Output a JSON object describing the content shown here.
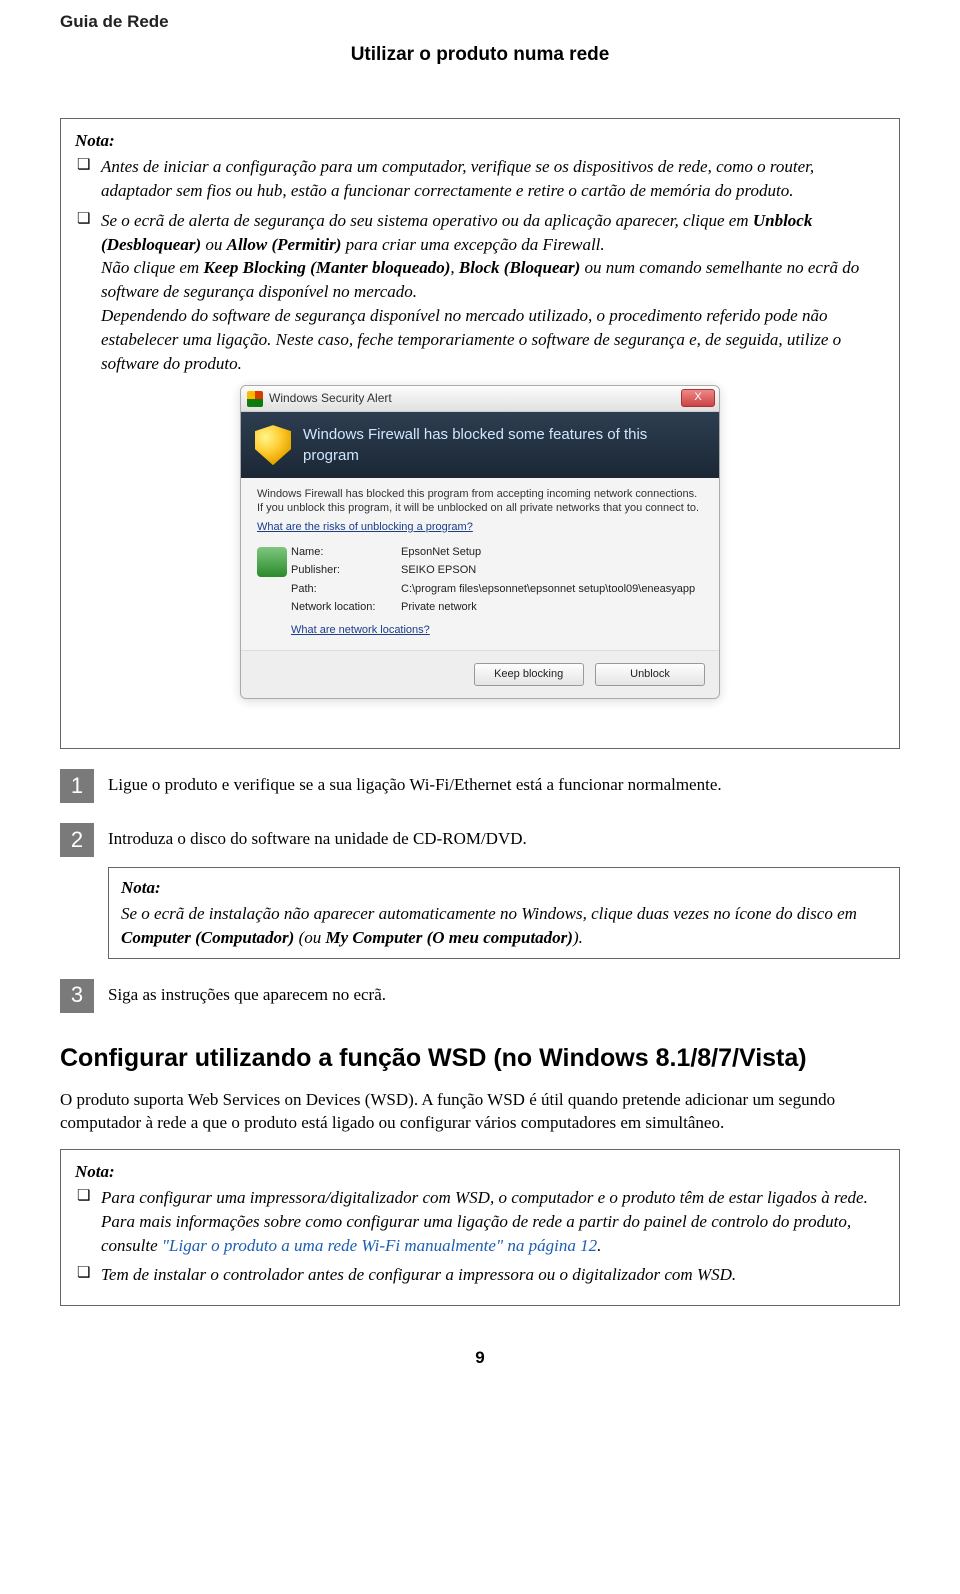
{
  "meta": {
    "running_head": "Guia de Rede",
    "chapter_title": "Utilizar o produto numa rede",
    "page_number": "9"
  },
  "note1": {
    "title": "Nota:",
    "items": [
      {
        "text": "Antes de iniciar a configuração para um computador, verifique se os dispositivos de rede, como o router, adaptador sem fios ou hub, estão a funcionar correctamente e retire o cartão de memória do produto."
      },
      {
        "html": "Se o ecrã de alerta de segurança do seu sistema operativo ou da aplicação aparecer, clique em <span class=\"bold-run\">Unblock (Desbloquear)</span> ou <span class=\"bold-run\">Allow (Permitir)</span> para criar uma excepção da Firewall.<br>Não clique em <span class=\"bold-run\">Keep Blocking (Manter bloqueado)</span>, <span class=\"bold-run\">Block (Bloquear)</span> ou num comando semelhante no ecrã do software de segurança disponível no mercado.<br>Dependendo do software de segurança disponível no mercado utilizado, o procedimento referido pode não estabelecer uma ligação. Neste caso, feche temporariamente o software de segurança e, de seguida, utilize o software do produto."
      }
    ]
  },
  "dialog": {
    "title": "Windows Security Alert",
    "banner": "Windows Firewall has blocked some features of this program",
    "intro": "Windows Firewall has blocked this program from accepting incoming network connections. If you unblock this program, it will be unblocked on all private networks that you connect to.",
    "risk_link": "What are the risks of unblocking a program?",
    "fields": {
      "name_label": "Name:",
      "name_value": "EpsonNet Setup",
      "publisher_label": "Publisher:",
      "publisher_value": "SEIKO EPSON",
      "path_label": "Path:",
      "path_value": "C:\\program files\\epsonnet\\epsonnet setup\\tool09\\eneasyapp",
      "netloc_label": "Network location:",
      "netloc_value": "Private network",
      "netloc_link": "What are network locations?"
    },
    "buttons": {
      "keep": "Keep blocking",
      "unblock": "Unblock"
    },
    "close_label": "X"
  },
  "steps": {
    "s1": {
      "num": "1",
      "text": "Ligue o produto e verifique se a sua ligação Wi-Fi/Ethernet está a funcionar normalmente."
    },
    "s2": {
      "num": "2",
      "text": "Introduza o disco do software na unidade de CD-ROM/DVD."
    },
    "s2_note": {
      "title": "Nota:",
      "html": "Se o ecrã de instalação não aparecer automaticamente no Windows, clique duas vezes no ícone do disco em <span class=\"bold-run\">Computer (Computador)</span> (ou <span class=\"bold-run\">My Computer (O meu computador)</span>)."
    },
    "s3": {
      "num": "3",
      "text": "Siga as instruções que aparecem no ecrã."
    }
  },
  "section": {
    "heading": "Configurar utilizando a função WSD (no Windows 8.1/8/7/Vista)",
    "para": "O produto suporta Web Services on Devices (WSD). A função WSD é útil quando pretende adicionar um segundo computador à rede a que o produto está ligado ou configurar vários computadores em simultâneo."
  },
  "note2": {
    "title": "Nota:",
    "items": [
      {
        "html": "Para configurar uma impressora/digitalizador com WSD, o computador e o produto têm de estar ligados à rede. Para mais informações sobre como configurar uma ligação de rede a partir do painel de controlo do produto, consulte <span class=\"link-text\">\"Ligar o produto a uma rede Wi-Fi manualmente\" na página 12</span>."
      },
      {
        "text": "Tem de instalar o controlador antes de configurar a impressora ou o digitalizador com WSD."
      }
    ]
  }
}
